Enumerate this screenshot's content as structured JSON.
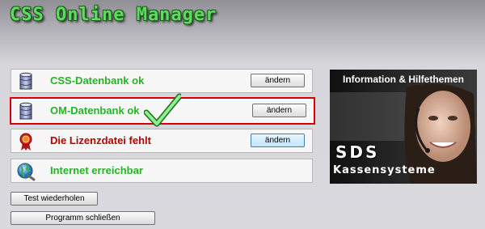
{
  "app": {
    "title": "CSS Online Manager"
  },
  "status_rows": [
    {
      "label": "CSS-Datenbank ok",
      "state": "ok",
      "icon": "database-icon",
      "button": "ändern"
    },
    {
      "label": "OM-Datenbank ok",
      "state": "ok",
      "icon": "database-icon",
      "button": "ändern",
      "highlighted": true
    },
    {
      "label": "Die Lizenzdatei fehlt",
      "state": "error",
      "icon": "award-ribbon-icon",
      "button": "ändern",
      "focused": true
    },
    {
      "label": "Internet erreichbar",
      "state": "ok",
      "icon": "globe-icon"
    }
  ],
  "buttons": {
    "retest": "Test wiederholen",
    "close": "Programm schließen"
  },
  "info_panel": {
    "title": "Information & Hilfethemen",
    "logo": "SDS",
    "subtitle": "Kassensysteme"
  },
  "colors": {
    "ok": "#24b424",
    "error": "#b40000",
    "highlight": "#d40000"
  }
}
